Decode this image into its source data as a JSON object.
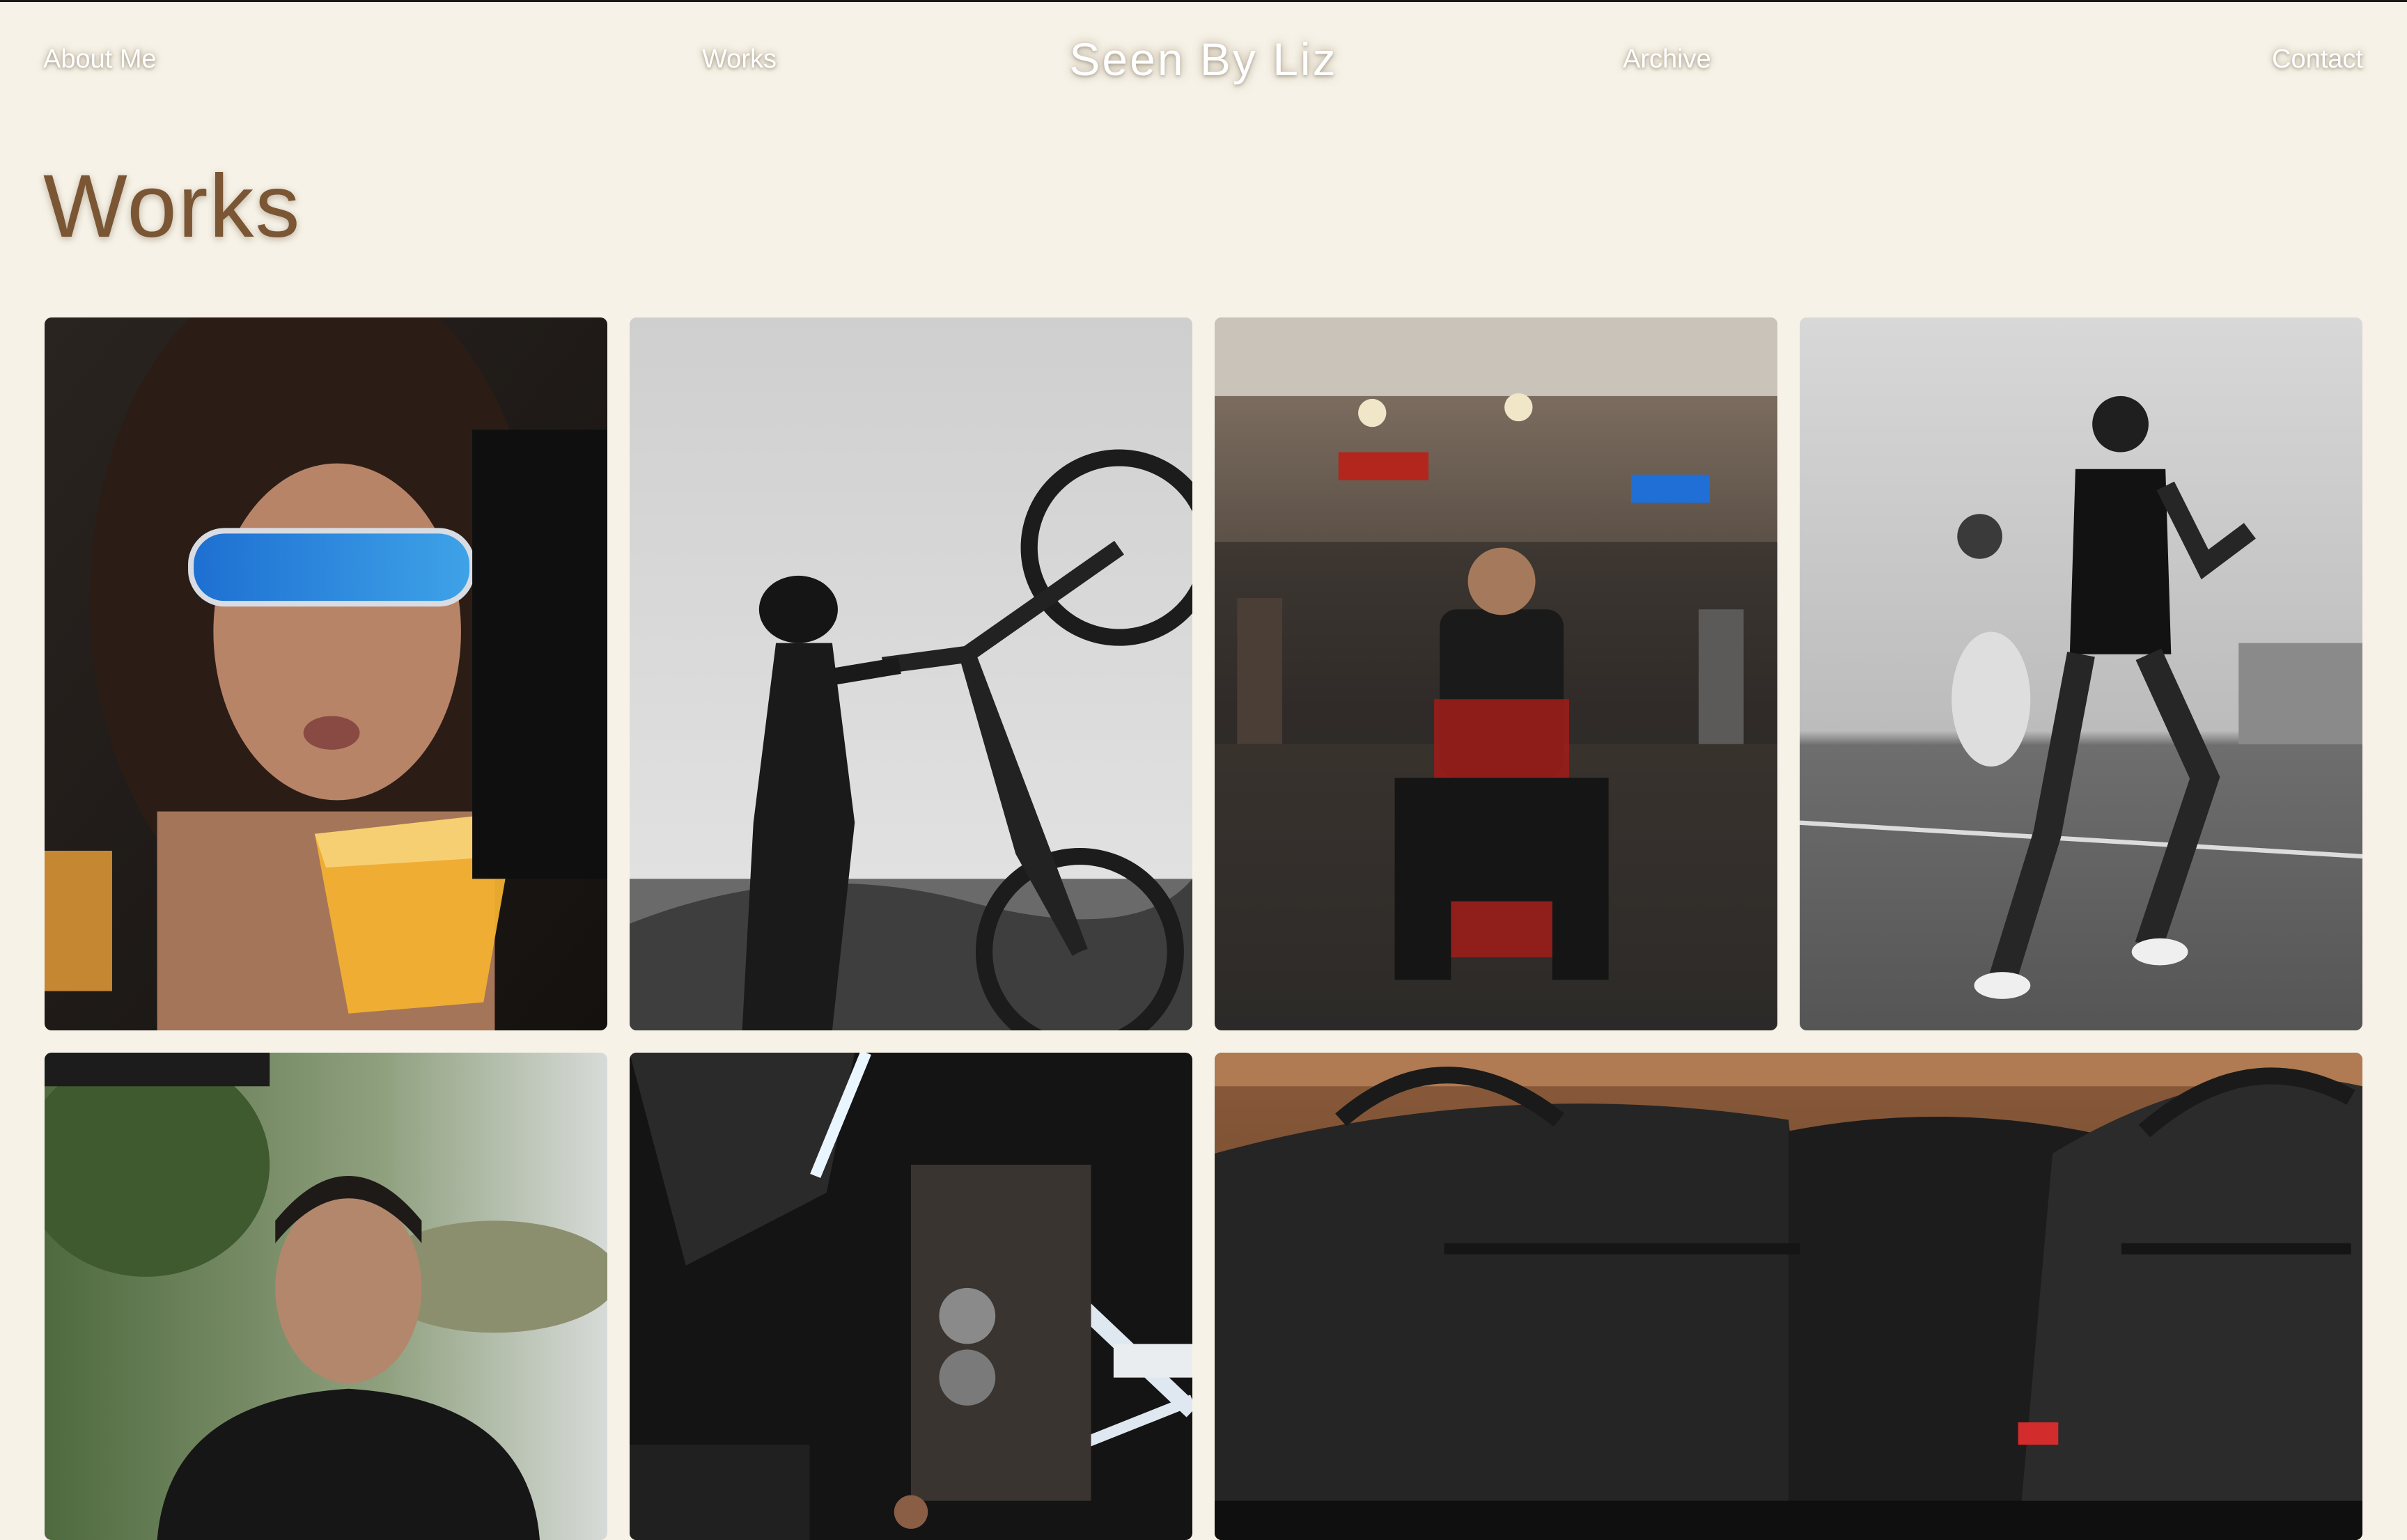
{
  "site": {
    "brand": "Seen By Liz"
  },
  "nav": {
    "about": "About Me",
    "works": "Works",
    "archive": "Archive",
    "contact": "Contact"
  },
  "page": {
    "title": "Works"
  },
  "gallery": {
    "items": [
      {
        "name": "photo-woman-sunglasses-drink",
        "scheme": "color"
      },
      {
        "name": "photo-mountain-biker-hill",
        "scheme": "monochrome"
      },
      {
        "name": "photo-man-red-chair-market",
        "scheme": "color"
      },
      {
        "name": "photo-runners-track",
        "scheme": "monochrome"
      },
      {
        "name": "photo-man-portrait-outdoors",
        "scheme": "color"
      },
      {
        "name": "photo-gym-interior",
        "scheme": "color"
      },
      {
        "name": "photo-duffel-bags",
        "scheme": "color"
      }
    ]
  },
  "colors": {
    "background": "#f6f2e7",
    "title": "#7a5634",
    "nav_text": "#ffffff"
  }
}
